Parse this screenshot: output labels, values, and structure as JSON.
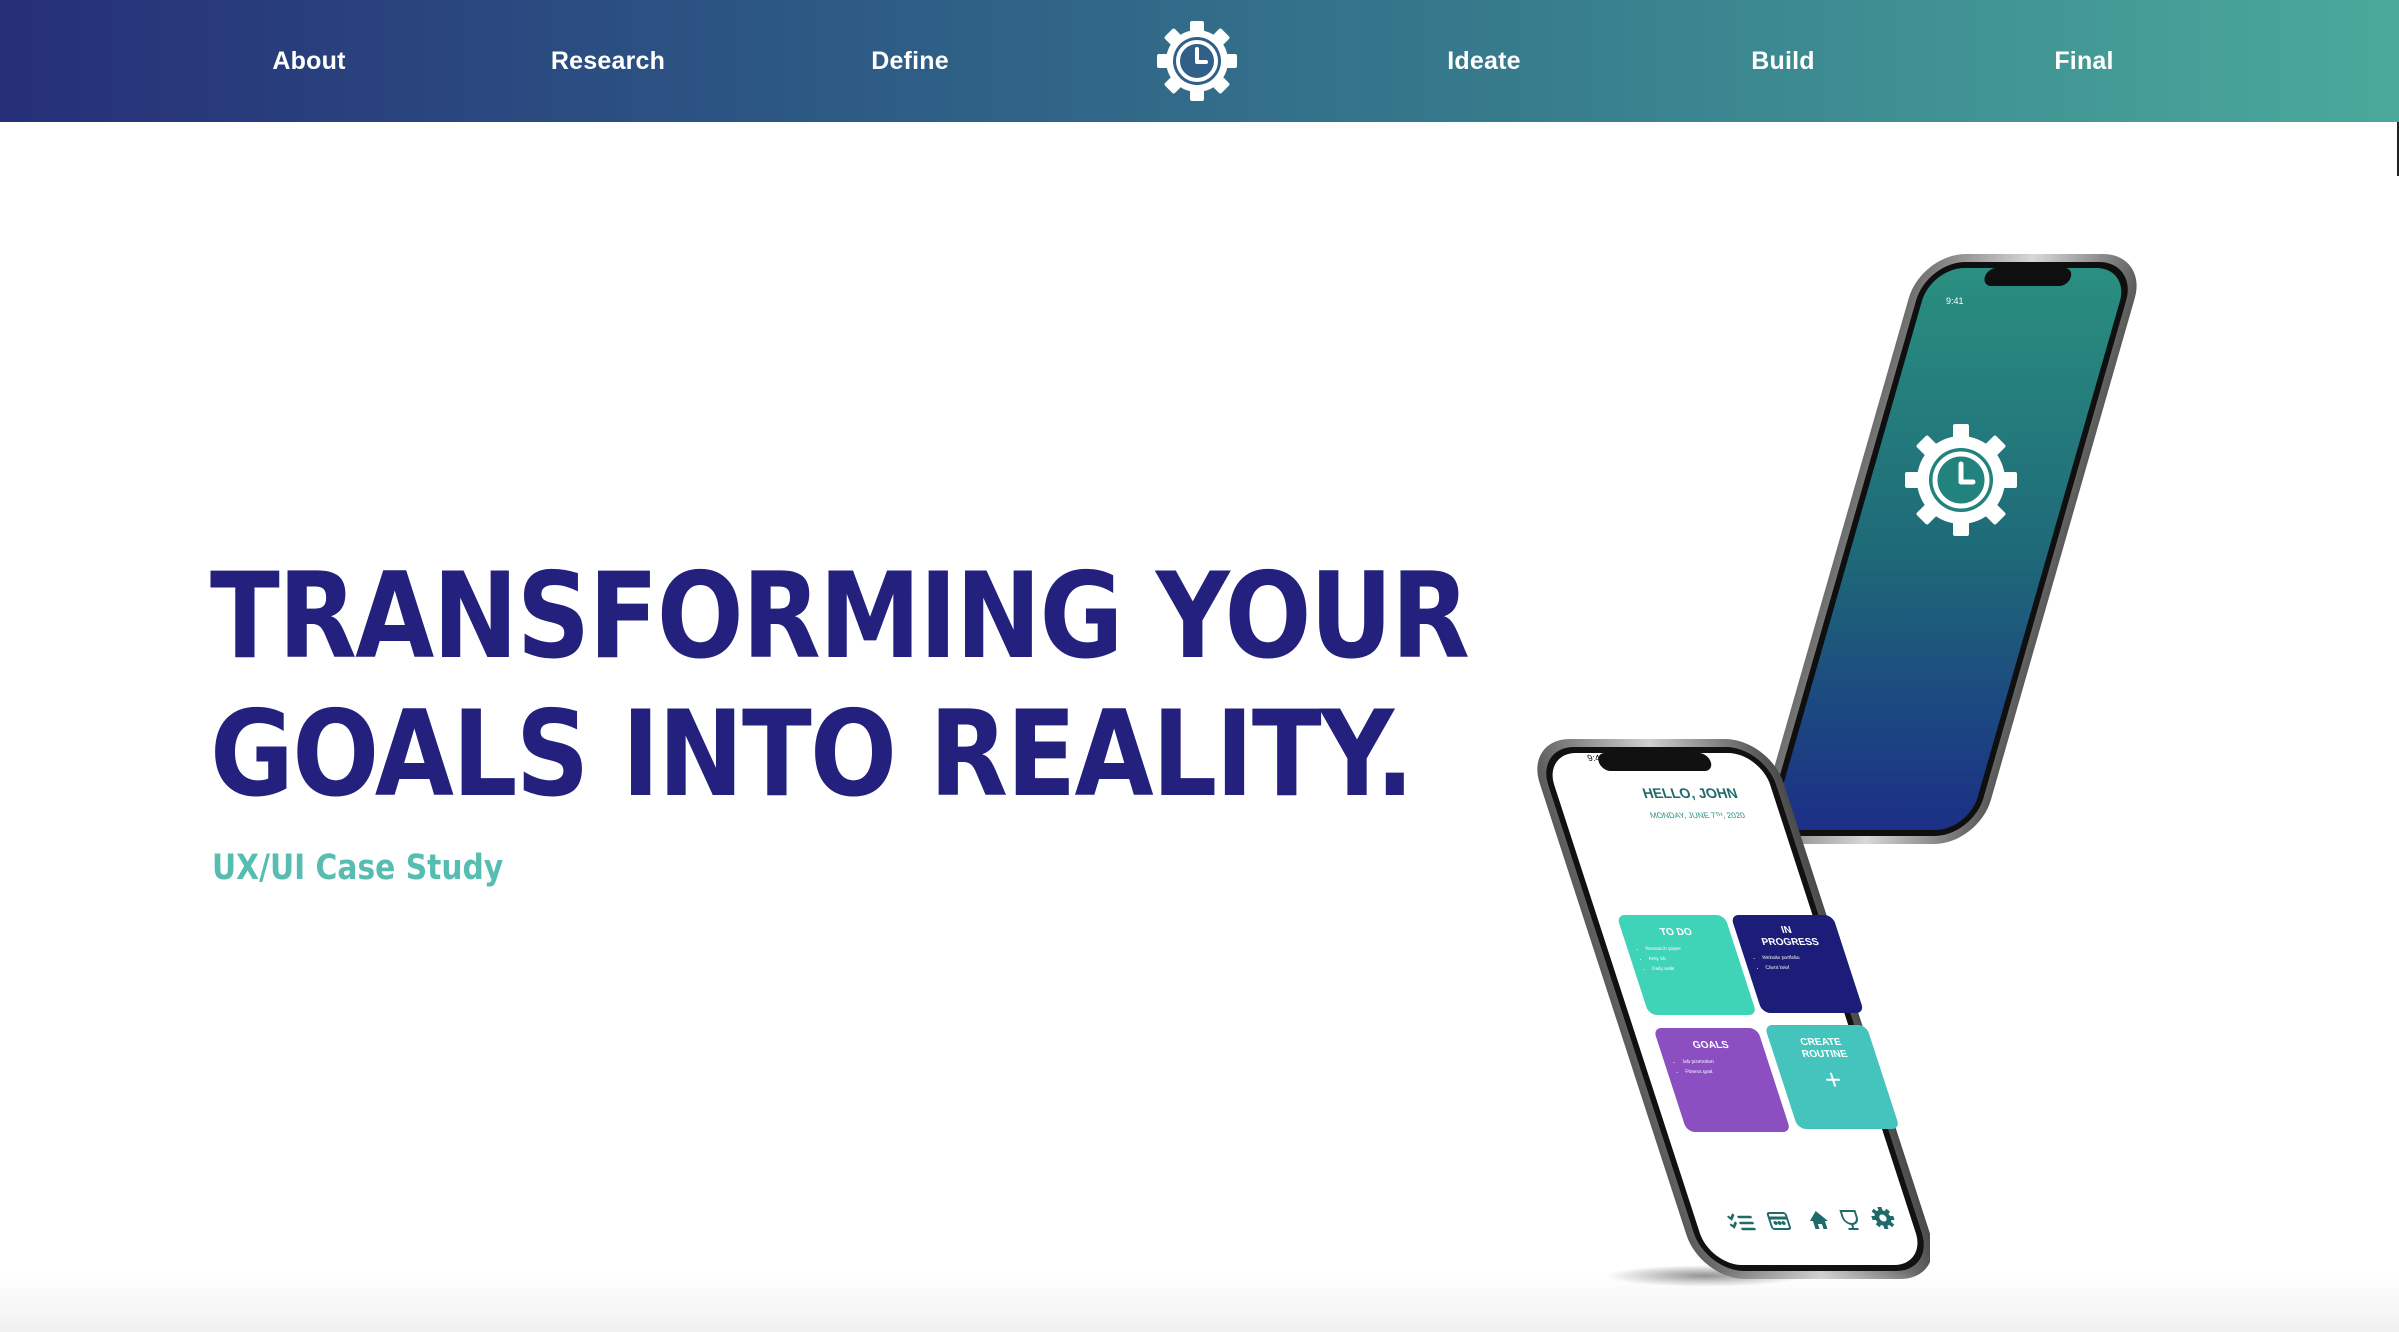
{
  "nav": {
    "links": [
      {
        "label": "About"
      },
      {
        "label": "Research"
      },
      {
        "label": "Define"
      },
      {
        "label": "Ideate"
      },
      {
        "label": "Build"
      },
      {
        "label": "Final"
      }
    ],
    "logo_icon": "gear-clock-icon",
    "gradient_start": "#262f78",
    "gradient_end": "#4aa99b"
  },
  "hero": {
    "title_line1": "TRANSFORMING YOUR",
    "title_line2": "GOALS INTO REALITY.",
    "subtitle": "UX/UI Case Study",
    "title_color": "#24217e",
    "subtitle_color": "#56bdb0"
  },
  "phone_back": {
    "status_time": "9:41",
    "app_icon": "gear-clock-icon"
  },
  "phone_front": {
    "status_time": "9:41",
    "greeting": "HELLO, JOHN",
    "date": "MONDAY, JUNE 7ᵀᴴ, 2020",
    "cards": [
      {
        "title": "TO DO",
        "items": [
          "Research paper",
          "Amy 16",
          "Daily walk"
        ],
        "color": "#3fd3b8"
      },
      {
        "title": "IN PROGRESS",
        "items": [
          "Website portfolio",
          "Client brief"
        ],
        "color": "#1c1d78"
      },
      {
        "title": "GOALS",
        "items": [
          "Job promotion",
          "Fitness goal"
        ],
        "color": "#8b4fc2"
      },
      {
        "title": "CREATE ROUTINE",
        "items": [
          "+"
        ],
        "color": "#45c4bd"
      }
    ],
    "tabbar_icons": [
      "checklist-icon",
      "calendar-icon",
      "home-icon",
      "trophy-icon",
      "settings-gear-icon"
    ]
  }
}
